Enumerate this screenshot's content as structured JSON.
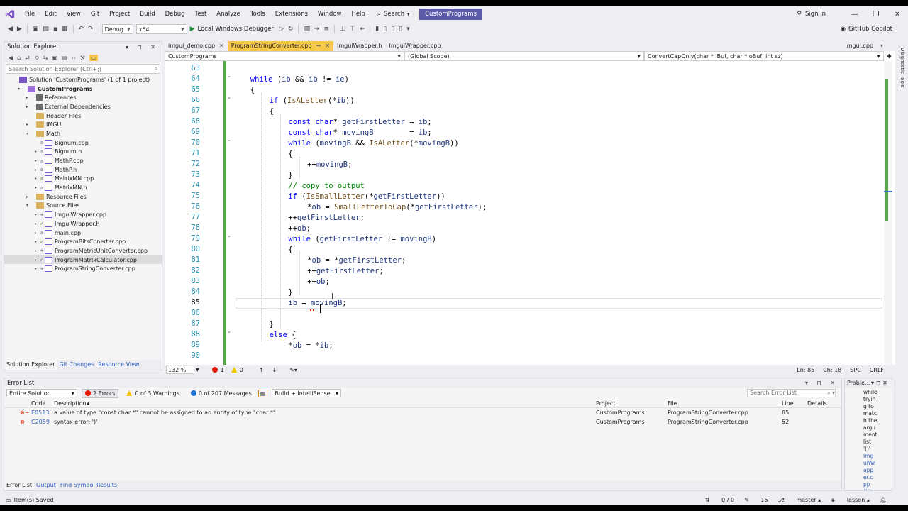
{
  "menu": {
    "items": [
      "File",
      "Edit",
      "View",
      "Git",
      "Project",
      "Build",
      "Debug",
      "Test",
      "Analyze",
      "Tools",
      "Extensions",
      "Window",
      "Help"
    ],
    "search_label": "Search",
    "solution_name": "CustomPrograms",
    "sign_in": "Sign in"
  },
  "toolbar": {
    "config": "Debug",
    "platform": "x64",
    "run_label": "Local Windows Debugger",
    "copilot": "GitHub Copilot"
  },
  "solution_explorer": {
    "title": "Solution Explorer",
    "search_placeholder": "Search Solution Explorer (Ctrl+;)",
    "tree": [
      {
        "label": "Solution 'CustomPrograms' (1 of 1 project)",
        "level": 0,
        "icon": "sln",
        "toggle": "",
        "status": ""
      },
      {
        "label": "CustomPrograms",
        "level": 1,
        "icon": "proj",
        "toggle": "▾",
        "status": "",
        "bold": true
      },
      {
        "label": "References",
        "level": 2,
        "icon": "ref",
        "toggle": "▸",
        "status": ""
      },
      {
        "label": "External Dependencies",
        "level": 2,
        "icon": "ref",
        "toggle": "▸",
        "status": ""
      },
      {
        "label": "Header Files",
        "level": 2,
        "icon": "folder",
        "toggle": "",
        "status": ""
      },
      {
        "label": "IMGUI",
        "level": 2,
        "icon": "folder",
        "toggle": "▸",
        "status": ""
      },
      {
        "label": "Math",
        "level": 2,
        "icon": "folder",
        "toggle": "▾",
        "status": ""
      },
      {
        "label": "Bignum.cpp",
        "level": 3,
        "icon": "cpp",
        "toggle": "",
        "status": "a"
      },
      {
        "label": "Bignum.h",
        "level": 3,
        "icon": "h",
        "toggle": "▸",
        "status": "a"
      },
      {
        "label": "MathP.cpp",
        "level": 3,
        "icon": "cpp",
        "toggle": "▸",
        "status": "a"
      },
      {
        "label": "MathP.h",
        "level": 3,
        "icon": "h",
        "toggle": "▸",
        "status": "a"
      },
      {
        "label": "MatrixMN.cpp",
        "level": 3,
        "icon": "cpp",
        "toggle": "▸",
        "status": "a"
      },
      {
        "label": "MatrixMN.h",
        "level": 3,
        "icon": "h",
        "toggle": "▸",
        "status": "a"
      },
      {
        "label": "Resource Files",
        "level": 2,
        "icon": "folder",
        "toggle": "▸",
        "status": ""
      },
      {
        "label": "Source Files",
        "level": 2,
        "icon": "folder",
        "toggle": "▾",
        "status": ""
      },
      {
        "label": "ImguiWrapper.cpp",
        "level": 3,
        "icon": "cpp",
        "toggle": "▸",
        "status": "+"
      },
      {
        "label": "ImguiWrapper.h",
        "level": 3,
        "icon": "h",
        "toggle": "▸",
        "status": "✓"
      },
      {
        "label": "main.cpp",
        "level": 3,
        "icon": "cpp",
        "toggle": "▸",
        "status": "a"
      },
      {
        "label": "ProgramBitsConerter.cpp",
        "level": 3,
        "icon": "cpp",
        "toggle": "▸",
        "status": "✓"
      },
      {
        "label": "ProgramMetricUnitConverter.cpp",
        "level": 3,
        "icon": "cpp",
        "toggle": "▸",
        "status": "+"
      },
      {
        "label": "ProgramMatrixCalculator.cpp",
        "level": 3,
        "icon": "cpp",
        "toggle": "▸",
        "status": "✓",
        "selected": true
      },
      {
        "label": "ProgramStringConverter.cpp",
        "level": 3,
        "icon": "cpp",
        "toggle": "▸",
        "status": "+"
      }
    ],
    "tabs": [
      "Solution Explorer",
      "Git Changes",
      "Resource View"
    ]
  },
  "editor": {
    "tabs": [
      {
        "label": "imgui_demo.cpp",
        "active": false
      },
      {
        "label": "ProgramStringConverter.cpp",
        "active": true
      },
      {
        "label": "ImguiWrapper.h",
        "active": false
      },
      {
        "label": "ImguiWrapper.cpp",
        "active": false
      }
    ],
    "right_tab": "imgui.cpp",
    "nav_project": "CustomPrograms",
    "nav_scope": "(Global Scope)",
    "nav_member": "ConvertCapOnly(char * iBuf, char * oBuf, int sz)",
    "current_line": 85,
    "lines": [
      {
        "n": 63,
        "indent": 0,
        "tokens": []
      },
      {
        "n": 64,
        "indent": 1,
        "tokens": [
          [
            "kw",
            "while"
          ],
          [
            "pr",
            " ("
          ],
          [
            "var",
            "ib"
          ],
          [
            "pr",
            " && "
          ],
          [
            "var",
            "ib"
          ],
          [
            "pr",
            " != "
          ],
          [
            "var",
            "ie"
          ],
          [
            "pr",
            ")"
          ]
        ]
      },
      {
        "n": 65,
        "indent": 1,
        "tokens": [
          [
            "pr",
            "{"
          ]
        ]
      },
      {
        "n": 66,
        "indent": 2,
        "tokens": [
          [
            "kw",
            "if"
          ],
          [
            "pr",
            " ("
          ],
          [
            "fn",
            "IsALetter"
          ],
          [
            "pr",
            "(*"
          ],
          [
            "var",
            "ib"
          ],
          [
            "pr",
            "))"
          ]
        ]
      },
      {
        "n": 67,
        "indent": 2,
        "tokens": [
          [
            "pr",
            "{"
          ]
        ]
      },
      {
        "n": 68,
        "indent": 3,
        "tokens": [
          [
            "kw",
            "const"
          ],
          [
            "pr",
            " "
          ],
          [
            "kw",
            "char"
          ],
          [
            "pr",
            "* "
          ],
          [
            "var",
            "getFirstLetter"
          ],
          [
            "pr",
            " = "
          ],
          [
            "var",
            "ib"
          ],
          [
            "pr",
            ";"
          ]
        ]
      },
      {
        "n": 69,
        "indent": 3,
        "tokens": [
          [
            "kw",
            "const"
          ],
          [
            "pr",
            " "
          ],
          [
            "kw",
            "char"
          ],
          [
            "pr",
            "* "
          ],
          [
            "var",
            "movingB"
          ],
          [
            "pr",
            "        = "
          ],
          [
            "var",
            "ib"
          ],
          [
            "pr",
            ";"
          ]
        ]
      },
      {
        "n": 70,
        "indent": 3,
        "tokens": [
          [
            "kw",
            "while"
          ],
          [
            "pr",
            " ("
          ],
          [
            "var",
            "movingB"
          ],
          [
            "pr",
            " && "
          ],
          [
            "fn",
            "IsALetter"
          ],
          [
            "pr",
            "(*"
          ],
          [
            "var",
            "movingB"
          ],
          [
            "pr",
            "))"
          ]
        ]
      },
      {
        "n": 71,
        "indent": 3,
        "tokens": [
          [
            "pr",
            "{"
          ]
        ]
      },
      {
        "n": 72,
        "indent": 4,
        "tokens": [
          [
            "pr",
            "++"
          ],
          [
            "var",
            "movingB"
          ],
          [
            "pr",
            ";"
          ]
        ]
      },
      {
        "n": 73,
        "indent": 3,
        "tokens": [
          [
            "pr",
            "}"
          ]
        ]
      },
      {
        "n": 74,
        "indent": 3,
        "tokens": [
          [
            "cm",
            "// copy to output"
          ]
        ]
      },
      {
        "n": 75,
        "indent": 3,
        "tokens": [
          [
            "kw",
            "if"
          ],
          [
            "pr",
            " ("
          ],
          [
            "fn",
            "IsSmallLetter"
          ],
          [
            "pr",
            "(*"
          ],
          [
            "var",
            "getFirstLetter"
          ],
          [
            "pr",
            "))"
          ]
        ]
      },
      {
        "n": 76,
        "indent": 4,
        "tokens": [
          [
            "pr",
            "*"
          ],
          [
            "var",
            "ob"
          ],
          [
            "pr",
            " = "
          ],
          [
            "fn",
            "SmallLetterToCap"
          ],
          [
            "pr",
            "(*"
          ],
          [
            "var",
            "getFirstLetter"
          ],
          [
            "pr",
            ");"
          ]
        ]
      },
      {
        "n": 77,
        "indent": 3,
        "tokens": [
          [
            "pr",
            "++"
          ],
          [
            "var",
            "getFirstLetter"
          ],
          [
            "pr",
            ";"
          ]
        ]
      },
      {
        "n": 78,
        "indent": 3,
        "tokens": [
          [
            "pr",
            "++"
          ],
          [
            "var",
            "ob"
          ],
          [
            "pr",
            ";"
          ]
        ]
      },
      {
        "n": 79,
        "indent": 3,
        "tokens": [
          [
            "kw",
            "while"
          ],
          [
            "pr",
            " ("
          ],
          [
            "var",
            "getFirstLetter"
          ],
          [
            "pr",
            " != "
          ],
          [
            "var",
            "movingB"
          ],
          [
            "pr",
            ")"
          ]
        ]
      },
      {
        "n": 80,
        "indent": 3,
        "tokens": [
          [
            "pr",
            "{"
          ]
        ]
      },
      {
        "n": 81,
        "indent": 4,
        "tokens": [
          [
            "pr",
            "*"
          ],
          [
            "var",
            "ob"
          ],
          [
            "pr",
            " = *"
          ],
          [
            "var",
            "getFirstLetter"
          ],
          [
            "pr",
            ";"
          ]
        ]
      },
      {
        "n": 82,
        "indent": 4,
        "tokens": [
          [
            "pr",
            "++"
          ],
          [
            "var",
            "getFirstLetter"
          ],
          [
            "pr",
            ";"
          ]
        ]
      },
      {
        "n": 83,
        "indent": 4,
        "tokens": [
          [
            "pr",
            "++"
          ],
          [
            "var",
            "ob"
          ],
          [
            "pr",
            ";"
          ]
        ]
      },
      {
        "n": 84,
        "indent": 3,
        "tokens": [
          [
            "pr",
            "}"
          ]
        ]
      },
      {
        "n": 85,
        "indent": 3,
        "tokens": [
          [
            "var",
            "ib"
          ],
          [
            "pr",
            " = "
          ],
          [
            "var",
            "movingB"
          ],
          [
            "pr",
            ";"
          ]
        ]
      },
      {
        "n": 86,
        "indent": 0,
        "tokens": []
      },
      {
        "n": 87,
        "indent": 2,
        "tokens": [
          [
            "pr",
            "}"
          ]
        ]
      },
      {
        "n": 88,
        "indent": 2,
        "tokens": [
          [
            "kw",
            "else"
          ],
          [
            "pr",
            " {"
          ]
        ]
      },
      {
        "n": 89,
        "indent": 3,
        "tokens": [
          [
            "pr",
            "*"
          ],
          [
            "var",
            "ob"
          ],
          [
            "pr",
            " = *"
          ],
          [
            "var",
            "ib"
          ],
          [
            "pr",
            ";"
          ]
        ]
      },
      {
        "n": 90,
        "indent": 0,
        "tokens": []
      }
    ],
    "folds": [
      64,
      66,
      70,
      79,
      88
    ],
    "status": {
      "zoom": "132 %",
      "errors": "1",
      "warnings": "0",
      "line": "Ln: 85",
      "char": "Ch: 18",
      "spc": "SPC",
      "crlf": "CRLF"
    }
  },
  "error_list": {
    "title": "Error List",
    "scope": "Entire Solution",
    "errors_filter": "2 Errors",
    "warnings_filter": "0 of 3 Warnings",
    "messages_filter": "0 of 207 Messages",
    "build_filter": "Build + IntelliSense",
    "search_placeholder": "Search Error List",
    "columns": [
      "Code",
      "Description",
      "Project",
      "File",
      "Line",
      "Details"
    ],
    "rows": [
      {
        "code": "E0513",
        "description": "a value of type \"const char *\" cannot be assigned to an entity of type \"char *\"",
        "project": "CustomPrograms",
        "file": "ProgramStringConverter.cpp",
        "line": "85",
        "kind": "intellisense"
      },
      {
        "code": "C2059",
        "description": "syntax error: ')'",
        "project": "CustomPrograms",
        "file": "ProgramStringConverter.cpp",
        "line": "52",
        "kind": "error"
      }
    ],
    "tabs": [
      "Error List",
      "Output",
      "Find Symbol Results"
    ]
  },
  "problem_pane": {
    "title": "Proble...",
    "text_lines": [
      "while",
      "tryin",
      "g to",
      "matc",
      "h the",
      "argu",
      "ment",
      "list",
      "'()'"
    ],
    "link_lines": [
      "Img",
      "uiWr",
      "app",
      "er.c",
      "pp",
      "(Lin"
    ]
  },
  "side_rail": "Diagnostic Tools",
  "statusbar": {
    "left": "Item(s) Saved",
    "sync": "0 / 0",
    "pencil": "15",
    "branch": "master",
    "repo": "lesson"
  }
}
